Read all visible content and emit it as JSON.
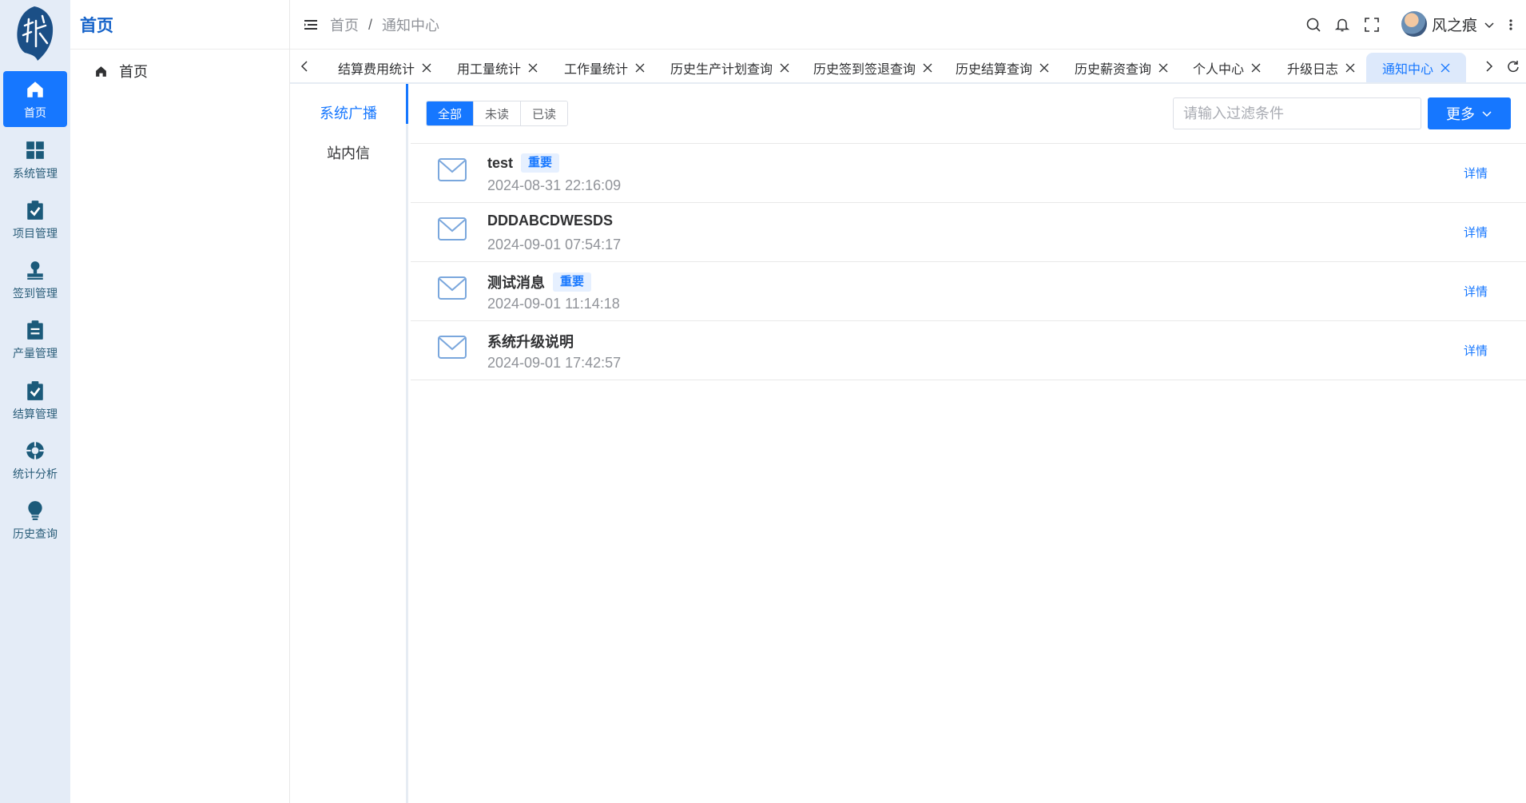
{
  "rail": {
    "items": [
      {
        "label": "首页",
        "icon": "home-icon"
      },
      {
        "label": "系统管理",
        "icon": "grid-icon"
      },
      {
        "label": "项目管理",
        "icon": "clipboard-check-icon"
      },
      {
        "label": "签到管理",
        "icon": "stamp-icon"
      },
      {
        "label": "产量管理",
        "icon": "clipboard-list-icon"
      },
      {
        "label": "结算管理",
        "icon": "clipboard-check-icon"
      },
      {
        "label": "统计分析",
        "icon": "lifebuoy-icon"
      },
      {
        "label": "历史查询",
        "icon": "bulb-icon"
      }
    ]
  },
  "submenu": {
    "title": "首页",
    "item": "首页"
  },
  "header": {
    "breadcrumb": [
      "首页",
      "通知中心"
    ],
    "separator": "/",
    "username": "风之痕"
  },
  "tabs": [
    {
      "label": "结算费用统计"
    },
    {
      "label": "用工量统计"
    },
    {
      "label": "工作量统计"
    },
    {
      "label": "历史生产计划查询"
    },
    {
      "label": "历史签到签退查询"
    },
    {
      "label": "历史结算查询"
    },
    {
      "label": "历史薪资查询"
    },
    {
      "label": "个人中心"
    },
    {
      "label": "升级日志"
    },
    {
      "label": "通知中心",
      "active": true
    }
  ],
  "leftnav": {
    "items": [
      "系统广播",
      "站内信"
    ]
  },
  "filters": {
    "options": [
      "全部",
      "未读",
      "已读"
    ],
    "placeholder": "请输入过滤条件",
    "more_label": "更多"
  },
  "messages": [
    {
      "title": "test",
      "tag": "重要",
      "time": "2024-08-31 22:16:09",
      "detail": "详情"
    },
    {
      "title": "DDDABCDWESDS",
      "tag": "",
      "time": "2024-09-01 07:54:17",
      "detail": "详情"
    },
    {
      "title": "测试消息",
      "tag": "重要",
      "time": "2024-09-01 11:14:18",
      "detail": "详情"
    },
    {
      "title": "系统升级说明",
      "tag": "",
      "time": "2024-09-01 17:42:57",
      "detail": "详情"
    }
  ],
  "colors": {
    "accent": "#1677ff",
    "rail_bg": "#e4ecf7",
    "icon_dark": "#1b5a7a"
  }
}
